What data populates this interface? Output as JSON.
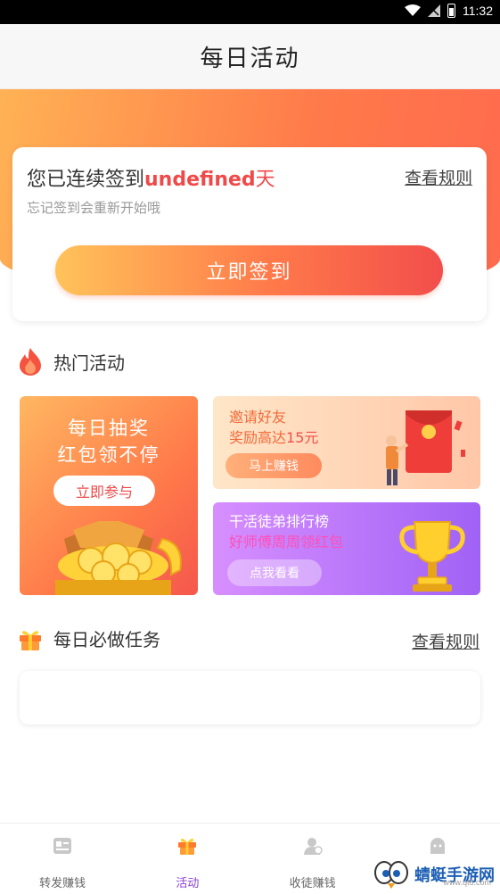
{
  "status_bar": {
    "time": "11:32",
    "icons": [
      "wifi-icon",
      "signal-icon",
      "battery-icon"
    ]
  },
  "header": {
    "title": "每日活动"
  },
  "sign_in": {
    "prefix": "您已连续签到",
    "streak_value": "undefined",
    "unit": "天",
    "rule_link": "查看规则",
    "hint": "忘记签到会重新开始哦",
    "button": "立即签到"
  },
  "hot_activities": {
    "title": "热门活动",
    "lottery": {
      "line1": "每日抽奖",
      "line2": "红包领不停",
      "button": "立即参与"
    },
    "invite": {
      "line1": "邀请好友",
      "line2_prefix": "奖励高达",
      "line2_highlight": "15元",
      "button": "马上赚钱"
    },
    "ranking": {
      "line1": "干活徒弟排行榜",
      "line2": "好师傅周周领红包",
      "button": "点我看看"
    }
  },
  "daily_tasks": {
    "title": "每日必做任务",
    "rule_link": "查看规则"
  },
  "tabbar": {
    "items": [
      {
        "label": "转发赚钱",
        "icon": "article-icon"
      },
      {
        "label": "活动",
        "icon": "gift-icon",
        "active": true
      },
      {
        "label": "收徒赚钱",
        "icon": "user-plus-icon"
      },
      {
        "label": "",
        "icon": "profile-icon"
      }
    ]
  },
  "watermark": {
    "text": "蜻蜓手游网",
    "url": "www.qt6.com"
  },
  "colors": {
    "accent": "#ef4a4a",
    "tab_active": "#8a3fd1",
    "hero_start": "#ffb255",
    "hero_end": "#ff6a4e"
  }
}
